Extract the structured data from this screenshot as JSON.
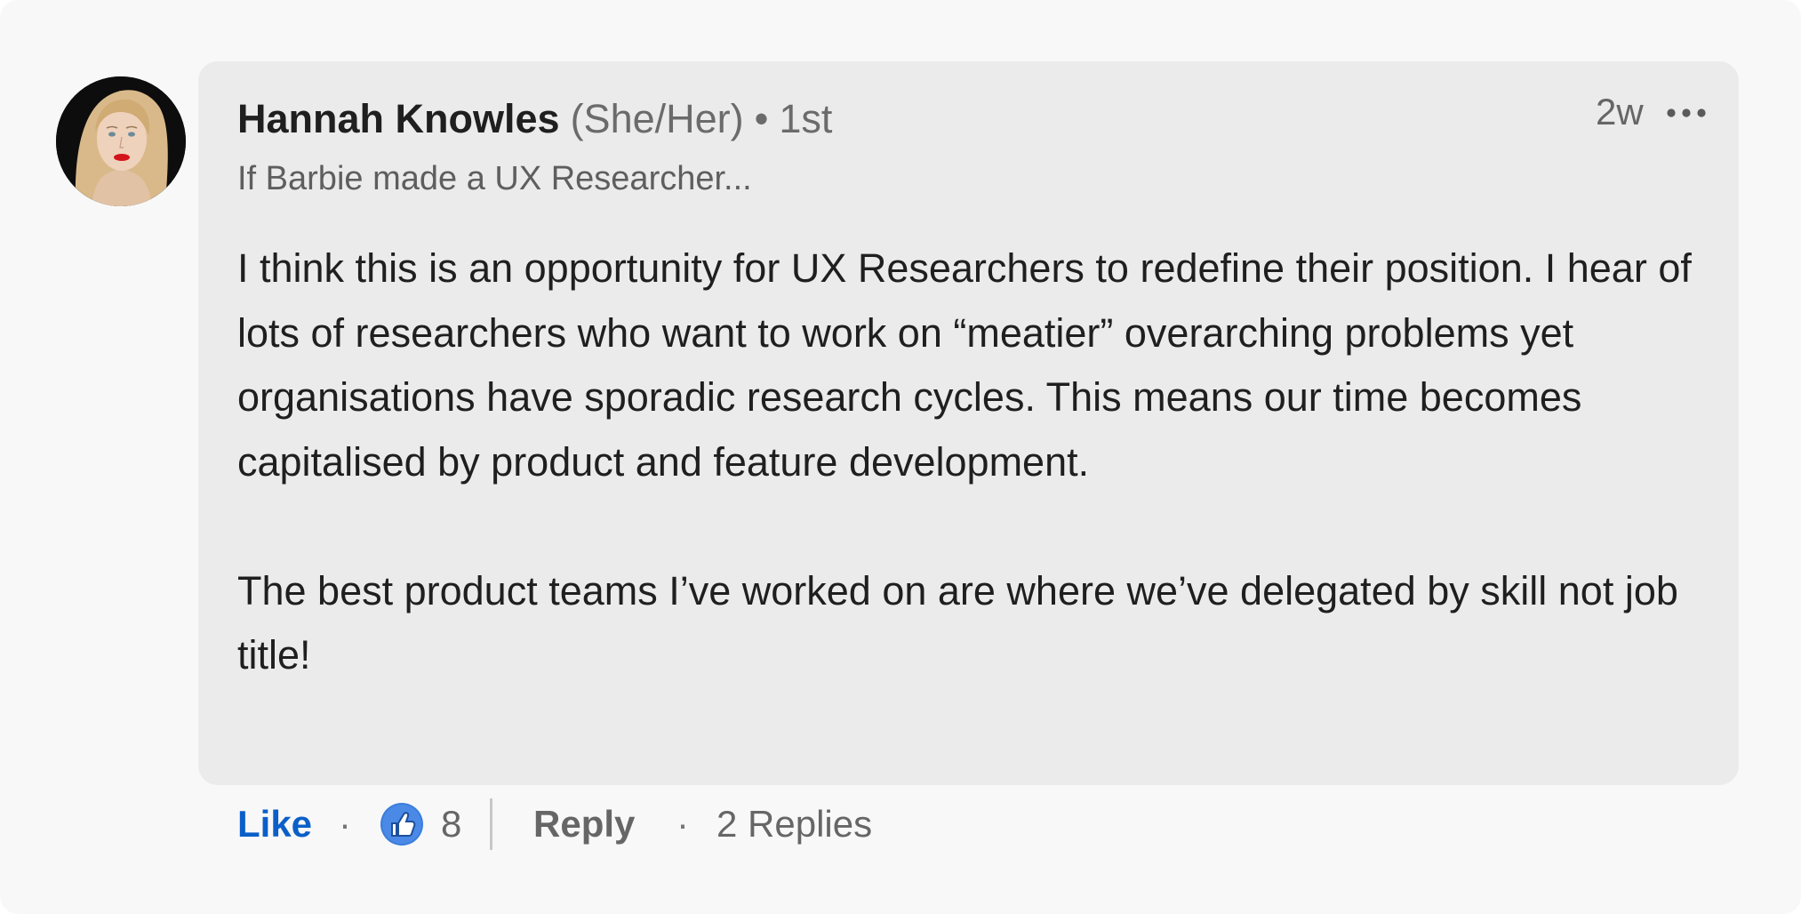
{
  "comment": {
    "author": {
      "name": "Hannah Knowles",
      "pronouns": "(She/Her)",
      "separator": "•",
      "degree": "1st",
      "headline": "If Barbie made a UX Researcher...",
      "avatar_icon": "profile-photo"
    },
    "timestamp": "2w",
    "more_icon": "ellipsis-icon",
    "body": [
      "I think this is an opportunity for UX Researchers to redefine their position. I hear of lots of researchers who want to work on “meatier” overarching problems yet organisations have sporadic research cycles. This means our time becomes capitalised by product and feature development.",
      "The best product teams I’ve worked on are where we’ve delegated by skill not job title!"
    ]
  },
  "actions": {
    "like_label": "Like",
    "separator": "·",
    "reaction_icon": "thumbs-up-icon",
    "reaction_count": "8",
    "reply_label": "Reply",
    "replies_label": "2 Replies"
  },
  "colors": {
    "background": "#f8f8f8",
    "bubble": "#ebebeb",
    "text_primary": "#1f1f1f",
    "text_secondary": "#666666",
    "accent_blue": "#0a5fc9",
    "reaction_blue": "#3b7ddd"
  }
}
